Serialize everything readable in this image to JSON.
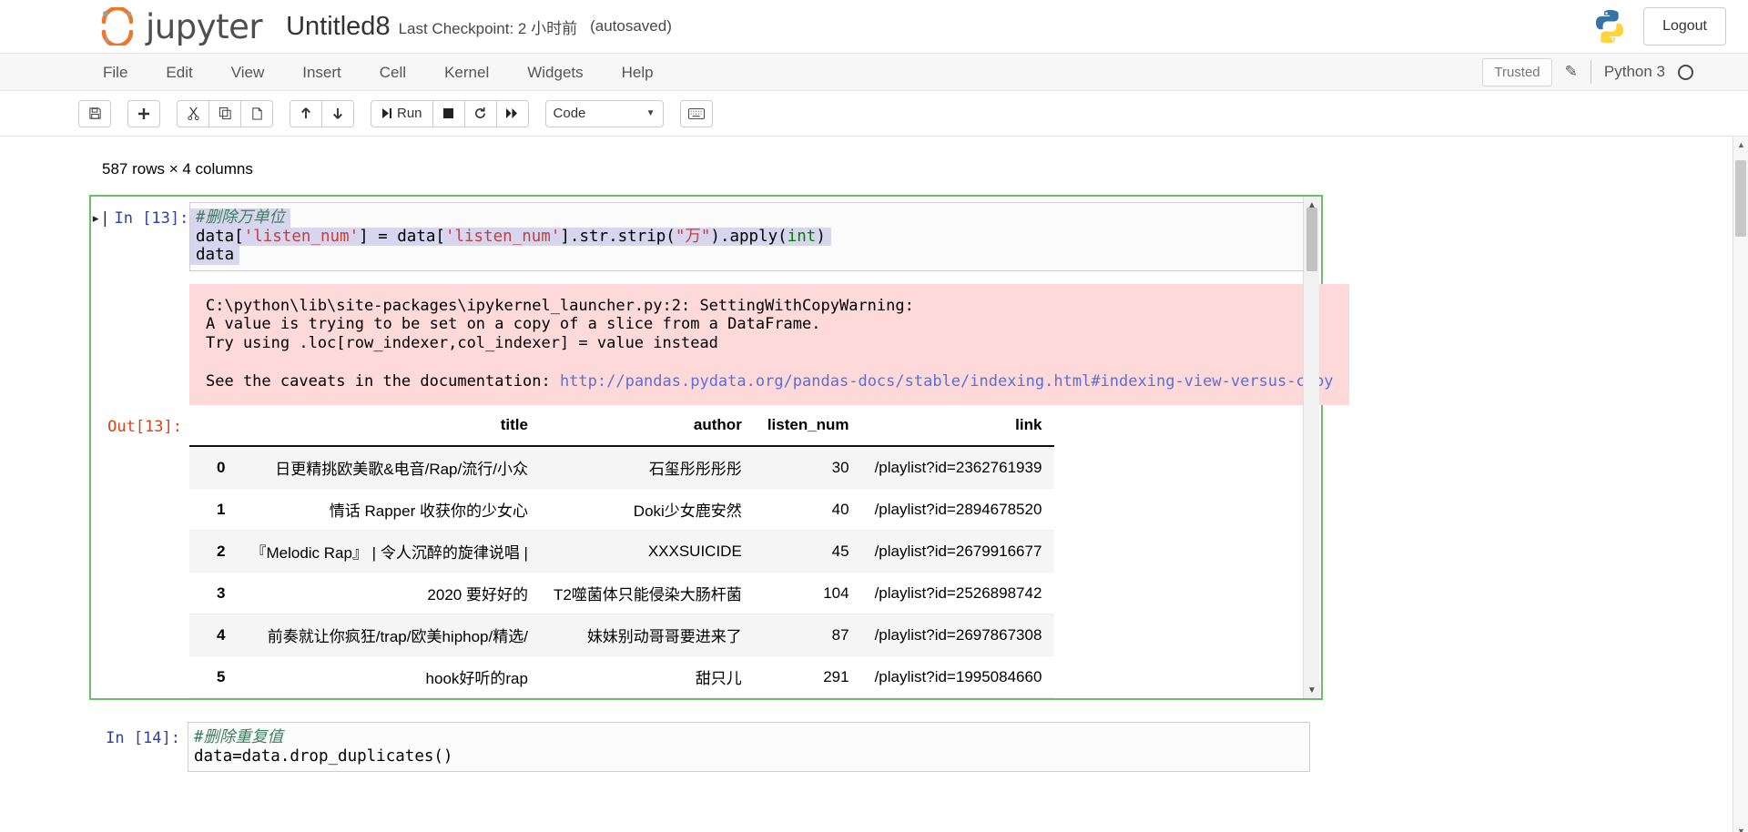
{
  "header": {
    "logo_text": "jupyter",
    "notebook_name": "Untitled8",
    "checkpoint": "Last Checkpoint: 2 小时前",
    "autosaved": "(autosaved)",
    "logout_label": "Logout",
    "brand_color": "#f37626"
  },
  "menubar": {
    "items": [
      {
        "label": "File"
      },
      {
        "label": "Edit"
      },
      {
        "label": "View"
      },
      {
        "label": "Insert"
      },
      {
        "label": "Cell"
      },
      {
        "label": "Kernel"
      },
      {
        "label": "Widgets"
      },
      {
        "label": "Help"
      }
    ],
    "trusted_label": "Trusted",
    "kernel_label": "Python 3"
  },
  "toolbar": {
    "save_glyph": "ὋE",
    "buttons": [
      {
        "name": "save-button",
        "glyph": "💾"
      },
      {
        "name": "insert-cell-below-button",
        "glyph": "✚"
      },
      {
        "name": "cut-cell-button",
        "glyph": "✂"
      },
      {
        "name": "copy-cell-button",
        "glyph": "⧉"
      },
      {
        "name": "paste-cell-button",
        "glyph": "📋"
      },
      {
        "name": "move-cell-up-button",
        "glyph": "⬆"
      },
      {
        "name": "move-cell-down-button",
        "glyph": "⬇"
      }
    ],
    "run_label": "Run",
    "run_glyph": "▶|",
    "stop_glyph": "■",
    "restart_glyph": "↻",
    "restart_run_all_glyph": "⏩",
    "cell_type": "Code",
    "keyboard_glyph": "⌨"
  },
  "notebook": {
    "rows_note": "587 rows × 4 columns",
    "cells": [
      {
        "name": "cell-in-13",
        "prompt": "In  [13]:",
        "selected": true,
        "code_lines": [
          {
            "segments": [
              {
                "t": "#删除万单位",
                "c": "comment"
              }
            ]
          },
          {
            "segments": [
              {
                "t": "data[",
                "c": "plain"
              },
              {
                "t": "'listen_num'",
                "c": "string"
              },
              {
                "t": "] = data[",
                "c": "plain"
              },
              {
                "t": "'listen_num'",
                "c": "string"
              },
              {
                "t": "].str.strip(",
                "c": "plain"
              },
              {
                "t": "\"万\"",
                "c": "string"
              },
              {
                "t": ").apply(",
                "c": "plain"
              },
              {
                "t": "int",
                "c": "builtin"
              },
              {
                "t": ")",
                "c": "plain"
              }
            ]
          },
          {
            "segments": [
              {
                "t": "data",
                "c": "plain"
              }
            ]
          }
        ],
        "warning_lines": [
          "C:\\python\\lib\\site-packages\\ipykernel_launcher.py:2: SettingWithCopyWarning:",
          "A value is trying to be set on a copy of a slice from a DataFrame.",
          "Try using .loc[row_indexer,col_indexer] = value instead",
          "",
          "See the caveats in the documentation: "
        ],
        "warning_link": "http://pandas.pydata.org/pandas-docs/stable/indexing.html#indexing-view-versus-copy",
        "out_prompt": "Out[13]:",
        "dataframe": {
          "index_header": "",
          "columns": [
            "title",
            "author",
            "listen_num",
            "link"
          ],
          "rows": [
            {
              "index": "0",
              "title": "日更精挑欧美歌&电音/Rap/流行/小众",
              "author": "石玺彤彤彤彤",
              "listen_num": "30",
              "link": "/playlist?id=2362761939"
            },
            {
              "index": "1",
              "title": "情话 Rapper 收获你的少女心",
              "author": "Doki少女鹿安然",
              "listen_num": "40",
              "link": "/playlist?id=2894678520"
            },
            {
              "index": "2",
              "title": "『Melodic Rap』 | 令人沉醉的旋律说唱 |",
              "author": "XXXSUICIDE",
              "listen_num": "45",
              "link": "/playlist?id=2679916677"
            },
            {
              "index": "3",
              "title": "2020 要好好的",
              "author": "T2噬菌体只能侵染大肠杆菌",
              "listen_num": "104",
              "link": "/playlist?id=2526898742"
            },
            {
              "index": "4",
              "title": "前奏就让你疯狂/trap/欧美hiphop/精选/",
              "author": "妹妹别动哥哥要进来了",
              "listen_num": "87",
              "link": "/playlist?id=2697867308"
            },
            {
              "index": "5",
              "title": "hook好听的rap",
              "author": "甜只儿",
              "listen_num": "291",
              "link": "/playlist?id=1995084660"
            }
          ]
        }
      },
      {
        "name": "cell-in-14",
        "prompt": "In  [14]:",
        "selected": false,
        "code_lines": [
          {
            "segments": [
              {
                "t": "#删除重复值",
                "c": "comment"
              }
            ]
          },
          {
            "segments": [
              {
                "t": "data=data.drop_duplicates()",
                "c": "plain"
              }
            ]
          }
        ]
      }
    ]
  }
}
